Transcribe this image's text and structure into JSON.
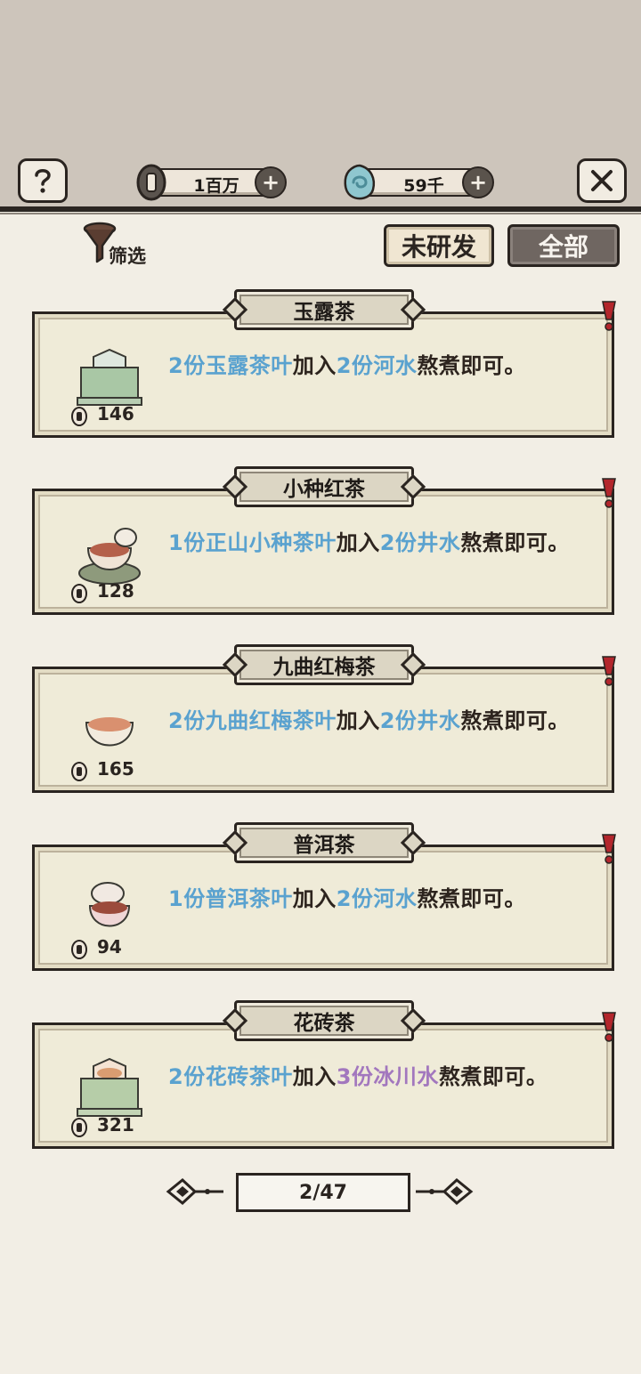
{
  "header": {
    "coins_value": "1百万",
    "jade_value": "59千",
    "help_icon": "help-icon",
    "close_icon": "close-icon"
  },
  "filter": {
    "label": "筛选"
  },
  "tabs": [
    {
      "label": "未研发",
      "selected": false
    },
    {
      "label": "全部",
      "selected": true
    }
  ],
  "teas": [
    {
      "name": "玉露茶",
      "price": "146",
      "recipe": [
        {
          "t": "2份玉露茶叶",
          "c": "blue"
        },
        {
          "t": "加入",
          "c": "dark"
        },
        {
          "t": "2份河水",
          "c": "blue"
        },
        {
          "t": "熬煮即可。",
          "c": "dark"
        }
      ]
    },
    {
      "name": "小种红茶",
      "price": "128",
      "recipe": [
        {
          "t": "1份正山小种茶叶",
          "c": "blue"
        },
        {
          "t": "加入",
          "c": "dark"
        },
        {
          "t": "2份井水",
          "c": "blue"
        },
        {
          "t": "熬煮即可。",
          "c": "dark"
        }
      ]
    },
    {
      "name": "九曲红梅茶",
      "price": "165",
      "recipe": [
        {
          "t": "2份九曲红梅茶叶",
          "c": "blue"
        },
        {
          "t": "加入",
          "c": "dark"
        },
        {
          "t": "2份井水",
          "c": "blue"
        },
        {
          "t": "熬煮即可。",
          "c": "dark"
        }
      ]
    },
    {
      "name": "普洱茶",
      "price": "94",
      "recipe": [
        {
          "t": "1份普洱茶叶",
          "c": "blue"
        },
        {
          "t": "加入",
          "c": "dark"
        },
        {
          "t": "2份河水",
          "c": "blue"
        },
        {
          "t": "熬煮即可。",
          "c": "dark"
        }
      ]
    },
    {
      "name": "花砖茶",
      "price": "321",
      "recipe": [
        {
          "t": "2份花砖茶叶",
          "c": "blue"
        },
        {
          "t": "加入",
          "c": "dark"
        },
        {
          "t": "3份冰川水",
          "c": "purple"
        },
        {
          "t": "熬煮即可。",
          "c": "dark"
        }
      ]
    }
  ],
  "pagination": {
    "label": "2/47"
  },
  "colors": {
    "ingredient_blue": "#5aa2cf",
    "ingredient_purple": "#a277be",
    "ink": "#2a2420",
    "accent_red": "#b3262c"
  }
}
